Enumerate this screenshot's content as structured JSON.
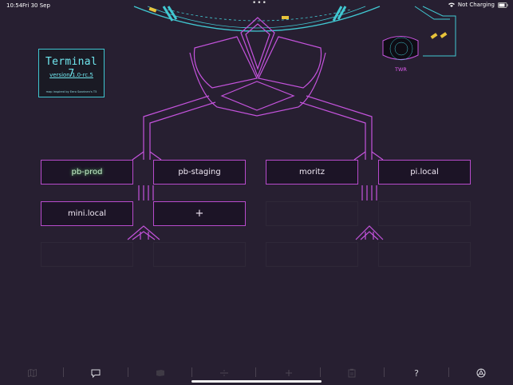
{
  "status_bar": {
    "time": "10:54",
    "date": "Fri 30 Sep",
    "dots": "•••",
    "charging": "Not Charging"
  },
  "title_card": {
    "title": "Terminal 7",
    "version": "version 1.0-rc.5",
    "credit": "map inspired by Eero Saarinen's T5"
  },
  "map": {
    "tower_label": "TWR",
    "colors": {
      "runway": "#41c8d2",
      "building": "#c453dc",
      "plane": "#e8c33a",
      "background": "#271f31"
    }
  },
  "gates": [
    {
      "label": "pb-prod",
      "state": "active"
    },
    {
      "label": "pb-staging",
      "state": "normal"
    },
    {
      "label": "moritz",
      "state": "normal"
    },
    {
      "label": "pi.local",
      "state": "normal"
    },
    {
      "label": "mini.local",
      "state": "normal"
    },
    {
      "label": "+",
      "state": "add"
    }
  ],
  "toolbar": {
    "icons": [
      "map-icon",
      "chat-bubble-icon",
      "log-icon",
      "divide-icon",
      "add-icon",
      "clipboard-icon",
      "help-icon",
      "settings-icon"
    ],
    "help_label": "?"
  }
}
